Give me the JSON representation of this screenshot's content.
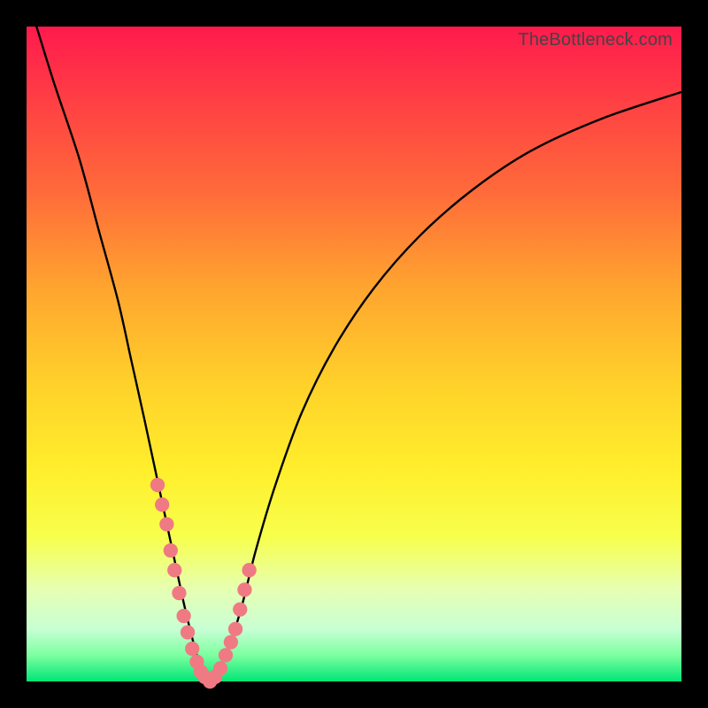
{
  "watermark": "TheBottleneck.com",
  "chart_data": {
    "type": "line",
    "title": "",
    "xlabel": "",
    "ylabel": "",
    "xlim": [
      0,
      100
    ],
    "ylim": [
      0,
      100
    ],
    "grid": false,
    "series": [
      {
        "name": "bottleneck-curve",
        "x": [
          0,
          4,
          8,
          11,
          14,
          16,
          18,
          19.5,
          21,
          22.5,
          24,
          25.2,
          26.3,
          27.2,
          28,
          29,
          30,
          31.2,
          33,
          35,
          38,
          42,
          47,
          53,
          60,
          68,
          77,
          88,
          100
        ],
        "values": [
          105,
          92,
          80,
          69,
          58,
          49,
          40,
          33,
          26,
          19,
          12,
          7,
          3,
          1,
          0,
          1,
          3,
          6,
          12,
          20,
          30,
          41,
          51,
          60,
          68,
          75,
          81,
          86,
          90
        ]
      }
    ],
    "markers": {
      "name": "highlighted-range",
      "color": "#ef7a83",
      "radius_frac": 0.011,
      "x": [
        20.0,
        20.7,
        21.4,
        22.0,
        22.6,
        23.3,
        24.0,
        24.6,
        25.3,
        26.0,
        26.6,
        27.2,
        28.0,
        28.8,
        29.6,
        30.4,
        31.2,
        31.9,
        32.6,
        33.3,
        34.0
      ],
      "values": [
        30,
        27,
        24,
        20,
        17,
        13.5,
        10,
        7.5,
        5,
        3,
        1.5,
        0.7,
        0,
        0.7,
        2,
        4,
        6,
        8,
        11,
        14,
        17
      ]
    }
  }
}
